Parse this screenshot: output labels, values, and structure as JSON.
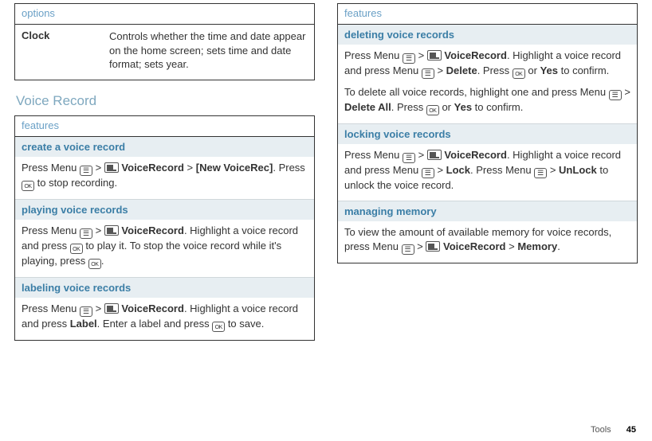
{
  "left": {
    "optionsHeader": "options",
    "optionRow": {
      "name": "Clock",
      "desc": "Controls whether the time and date appear on the home screen; sets time and date format; sets year."
    },
    "sectionHeading": "Voice Record",
    "featuresHeader": "features",
    "f1": {
      "title": "create a voice record",
      "p1_a": "Press Menu ",
      "p1_b": " > ",
      "p1_c": " VoiceRecord",
      "p1_d": " > ",
      "p1_e": "[New VoiceRec]",
      "p1_f": ". Press ",
      "p1_g": " to stop recording."
    },
    "f2": {
      "title": "playing voice records",
      "p1_a": "Press Menu ",
      "p1_b": " > ",
      "p1_c": " VoiceRecord",
      "p1_d": ". Highlight a voice record and press ",
      "p1_e": " to play it. To stop the voice record while it's playing, press ",
      "p1_f": "."
    },
    "f3": {
      "title": "labeling voice records",
      "p1_a": "Press Menu ",
      "p1_b": " > ",
      "p1_c": " VoiceRecord",
      "p1_d": ". Highlight a voice record and press ",
      "p1_e": "Label",
      "p1_f": ". Enter a label and press ",
      "p1_g": " to save."
    }
  },
  "right": {
    "featuresHeader": "features",
    "f1": {
      "title": "deleting voice records",
      "p1_a": "Press Menu ",
      "p1_b": " > ",
      "p1_c": " VoiceRecord",
      "p1_d": ". Highlight a voice record and press Menu ",
      "p1_e": " > ",
      "p1_f": "Delete",
      "p1_g": ". Press ",
      "p1_h": " or ",
      "p1_i": "Yes",
      "p1_j": " to confirm.",
      "p2_a": "To delete all voice records, highlight one and press Menu ",
      "p2_b": " > ",
      "p2_c": "Delete All",
      "p2_d": ". Press ",
      "p2_e": " or ",
      "p2_f": "Yes",
      "p2_g": " to confirm."
    },
    "f2": {
      "title": "locking voice records",
      "p1_a": "Press Menu ",
      "p1_b": " > ",
      "p1_c": " VoiceRecord",
      "p1_d": ". Highlight a voice record and press Menu ",
      "p1_e": " > ",
      "p1_f": "Lock",
      "p1_g": ". Press Menu ",
      "p1_h": " > ",
      "p1_i": "UnLock",
      "p1_j": " to unlock the voice record."
    },
    "f3": {
      "title": "managing memory",
      "p1_a": "To view the amount of available memory for voice records, press Menu ",
      "p1_b": " > ",
      "p1_c": " VoiceRecord",
      "p1_d": " > ",
      "p1_e": "Memory",
      "p1_f": "."
    }
  },
  "footer": {
    "section": "Tools",
    "page": "45"
  }
}
